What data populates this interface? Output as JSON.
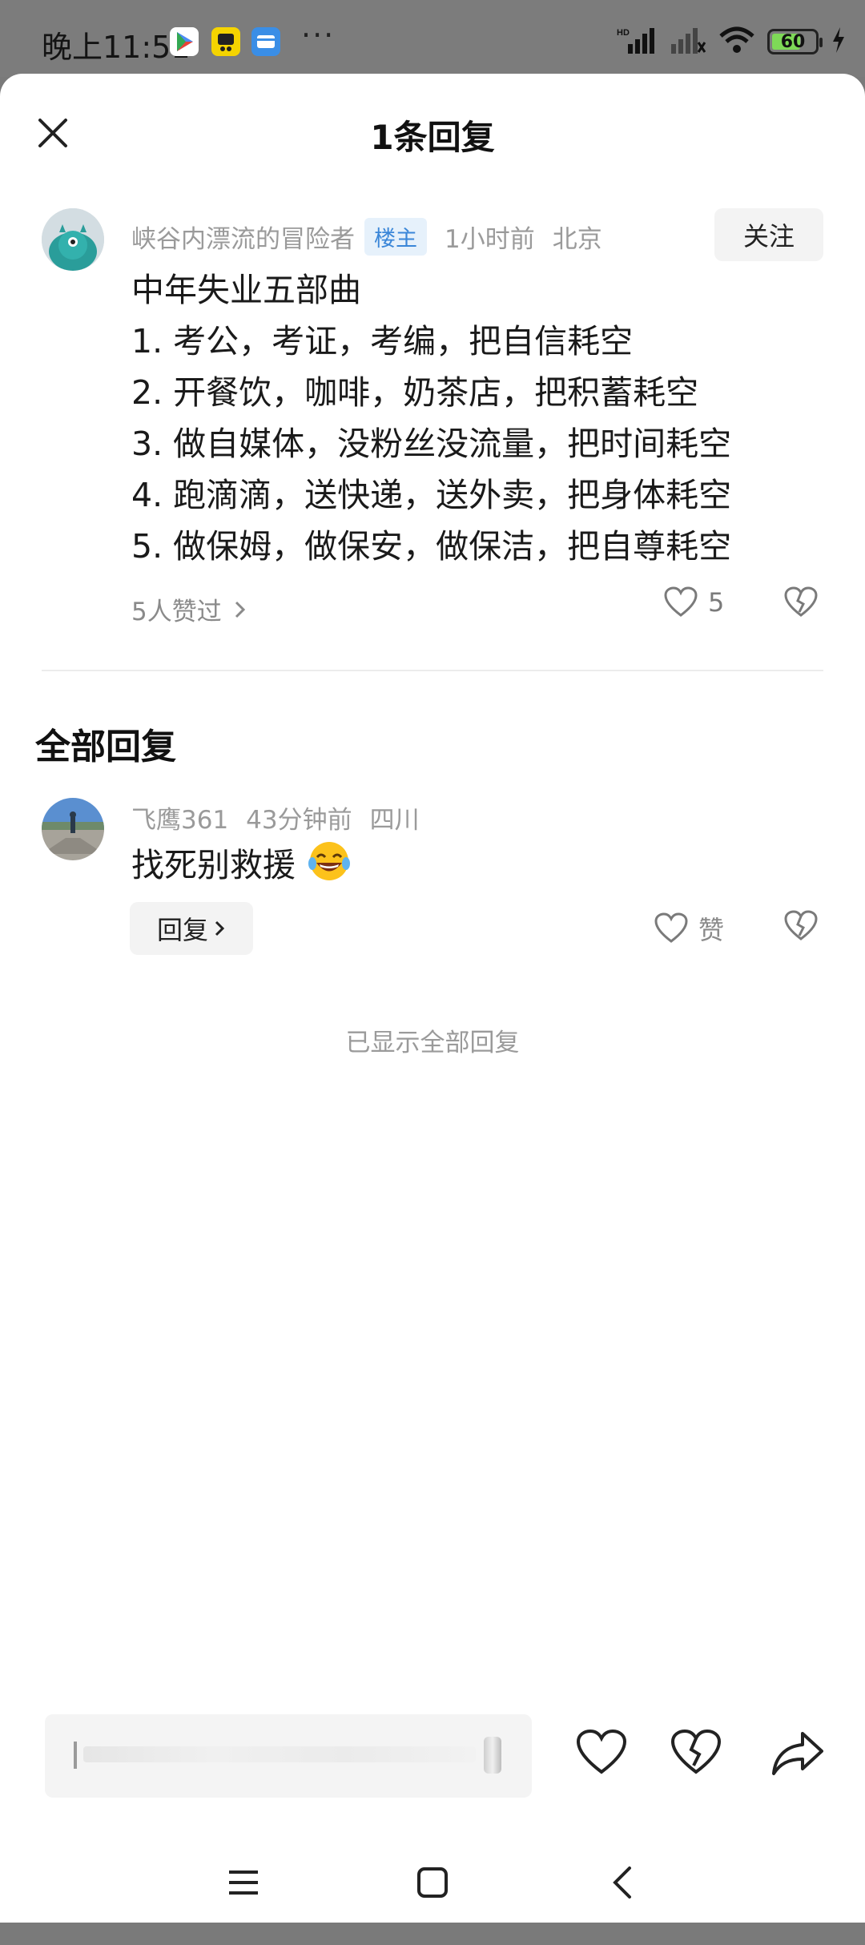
{
  "status_bar": {
    "time": "晚上11:51",
    "dots": "···",
    "battery": "60",
    "colors": {
      "battery_fill": "#7ed957"
    },
    "icons": [
      "play-store-icon",
      "app-icon",
      "message-icon",
      "signal-icon",
      "signal-icon-2",
      "wifi-icon",
      "battery-icon",
      "charging-icon"
    ]
  },
  "header": {
    "title": "1条回复",
    "close_icon": "close-icon"
  },
  "main_comment": {
    "author": "峡谷内漂流的冒险者",
    "badge": "楼主",
    "time": "1小时前",
    "location": "北京",
    "follow_label": "关注",
    "lines": [
      "中年失业五部曲",
      "1. 考公，考证，考编，把自信耗空",
      "2. 开餐饮，咖啡，奶茶店，把积蓄耗空",
      "3. 做自媒体，没粉丝没流量，把时间耗空",
      "4. 跑滴滴，送快递，送外卖，把身体耗空",
      "5. 做保姆，做保安，做保洁，把自尊耗空"
    ],
    "likes_summary": "5人赞过",
    "like_count": "5"
  },
  "replies_section": {
    "title": "全部回复",
    "replies": [
      {
        "author": "飞鹰361",
        "time": "43分钟前",
        "location": "四川",
        "text": "找死别救援",
        "emoji": "😂",
        "reply_label": "回复",
        "like_label": "赞"
      }
    ],
    "all_shown": "已显示全部回复"
  },
  "colors": {
    "badge_bg": "#e6f1fb",
    "badge_text": "#3a86d8",
    "avatar1": "#2a9d9a"
  }
}
